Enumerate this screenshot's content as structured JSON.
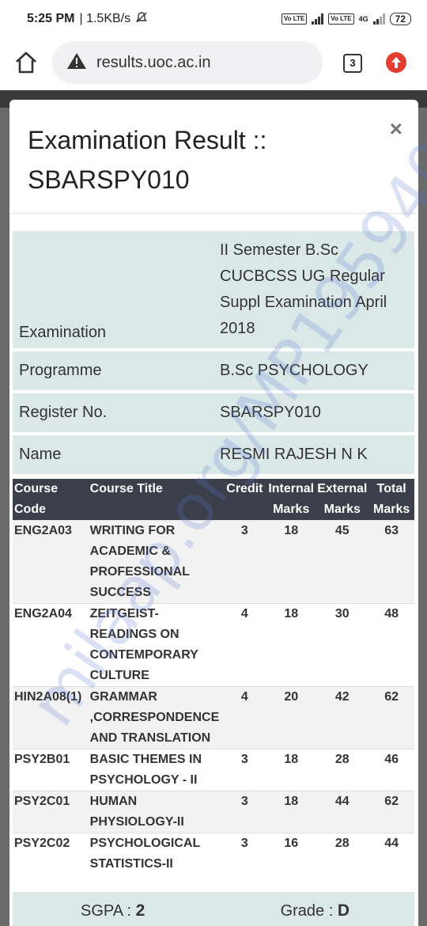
{
  "status_bar": {
    "time": "5:25 PM",
    "speed": "| 1.5KB/s",
    "battery": "72",
    "sim1_label": "Vo LTE",
    "sim2_label": "Vo LTE",
    "net_label": "4G"
  },
  "browser": {
    "url": "results.uoc.ac.in",
    "tab_count": "3",
    "accent_color": "#e23d2e"
  },
  "modal": {
    "title": "Examination Result :: SBARSPY010",
    "close_label": "×"
  },
  "info": {
    "examination_label": "Examination",
    "examination_value": "II Semester B.Sc CUCBCSS UG Regular Suppl Examination April 2018",
    "programme_label": "Programme",
    "programme_value": "B.Sc PSYCHOLOGY",
    "register_label": "Register No.",
    "register_value": "SBARSPY010",
    "name_label": "Name",
    "name_value": "RESMI RAJESH N K"
  },
  "marks_table": {
    "headers": [
      "Course Code",
      "Course Title",
      "Credit",
      "Internal Marks",
      "External Marks",
      "Total Marks"
    ],
    "rows": [
      [
        "ENG2A03",
        "WRITING FOR ACADEMIC & PROFESSIONAL SUCCESS",
        "3",
        "18",
        "45",
        "63"
      ],
      [
        "ENG2A04",
        "ZEITGEIST- READINGS ON CONTEMPORARY CULTURE",
        "4",
        "18",
        "30",
        "48"
      ],
      [
        "HIN2A08(1)",
        "GRAMMAR ,CORRESPONDENCE AND TRANSLATION",
        "4",
        "20",
        "42",
        "62"
      ],
      [
        "PSY2B01",
        "BASIC THEMES IN PSYCHOLOGY - II",
        "3",
        "18",
        "28",
        "46"
      ],
      [
        "PSY2C01",
        "HUMAN PHYSIOLOGY-II",
        "3",
        "18",
        "44",
        "62"
      ],
      [
        "PSY2C02",
        "PSYCHOLOGICAL STATISTICS-II",
        "3",
        "16",
        "28",
        "44"
      ]
    ]
  },
  "summary": {
    "sgpa_label": "SGPA : ",
    "sgpa_value": "2",
    "grade_label": "Grade : ",
    "grade_value": "D"
  },
  "watermark": "milaap.org/MP195940"
}
